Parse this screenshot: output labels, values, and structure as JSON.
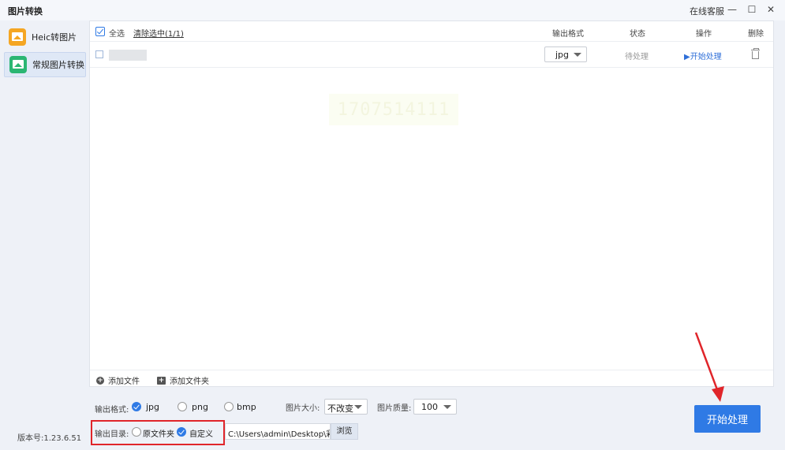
{
  "window": {
    "title": "图片转换",
    "support_label": "在线客服",
    "minimize_glyph": "—",
    "maximize_glyph": "☐",
    "close_glyph": "✕"
  },
  "sidebar": {
    "items": [
      {
        "label": "Heic转图片",
        "icon": "image-icon",
        "color": "#f5a623",
        "active": false
      },
      {
        "label": "常规图片转换",
        "icon": "image-icon",
        "color": "#2bb673",
        "active": true
      }
    ],
    "version": "版本号:1.23.6.51"
  },
  "table": {
    "select_all_label": "全选",
    "clear_selection_label": "清除选中(1/1)",
    "columns": {
      "format": "输出格式",
      "status": "状态",
      "action": "操作",
      "delete": "删除"
    },
    "rows": [
      {
        "format": "jpg",
        "status": "待处理",
        "action": "▶开始处理"
      }
    ]
  },
  "watermark_text": "1707514111",
  "footer_actions": {
    "add_file": "添加文件",
    "add_folder": "添加文件夹"
  },
  "options": {
    "output_format_label": "输出格式:",
    "formats": [
      {
        "label": "jpg",
        "selected": true
      },
      {
        "label": "png",
        "selected": false
      },
      {
        "label": "bmp",
        "selected": false
      }
    ],
    "image_size_label": "图片大小:",
    "image_size_value": "不改变",
    "image_quality_label": "图片质量:",
    "image_quality_value": "100",
    "output_dir_label": "输出目录:",
    "dir_options": [
      {
        "label": "原文件夹",
        "selected": false
      },
      {
        "label": "自定义",
        "selected": true
      }
    ],
    "output_path": "C:\\Users\\admin\\Desktop\\彩",
    "browse_label": "浏览"
  },
  "start_button_label": "开始处理",
  "colors": {
    "accent": "#2f7ae5",
    "highlight_box": "#e0252a",
    "annotation_arrow": "#e0252a"
  }
}
